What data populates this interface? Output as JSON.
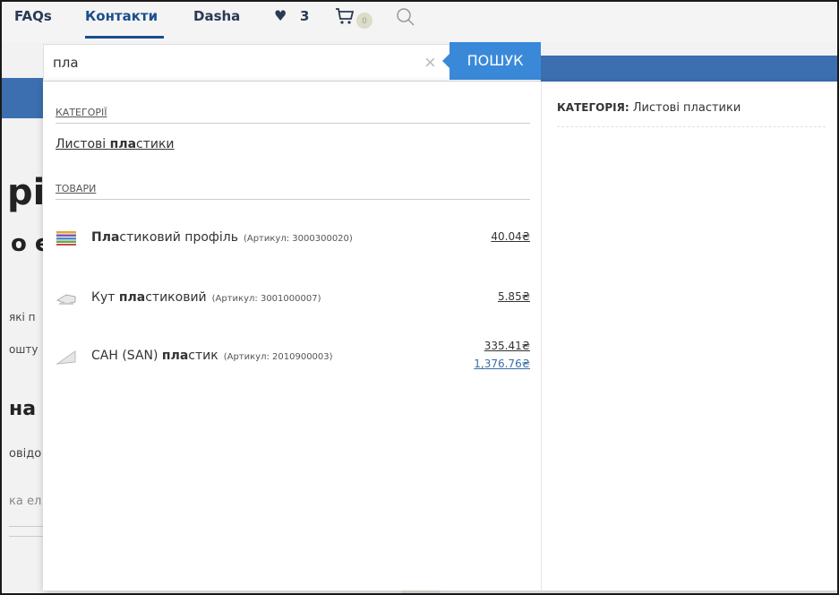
{
  "nav": {
    "faqs": "FAQs",
    "contacts": "Контакти",
    "user": "Dasha",
    "wishlist_count": "3",
    "cart_count": "0"
  },
  "background": {
    "big1": "рі",
    "big2": "о є",
    "small1": "які п",
    "small2": "ошту",
    "med": "на д",
    "small3": "овідо",
    "small4": "ка ел"
  },
  "search": {
    "value": "пла",
    "button_label": "ПОШУК"
  },
  "dropdown": {
    "categories_heading": "КАТЕГОРІЇ",
    "category_link": {
      "prefix": "Листові ",
      "bold": "пла",
      "suffix": "стики"
    },
    "products_heading": "ТОВАРИ",
    "products": [
      {
        "bold": "Пла",
        "rest": "стиковий профіль",
        "sku": "(Артикул: 3000300020)",
        "price": "40.04₴",
        "price2": ""
      },
      {
        "prefix": "Кут ",
        "bold": "пла",
        "rest": "стиковий",
        "sku": "(Артикул: 3001000007)",
        "price": "5.85₴",
        "price2": ""
      },
      {
        "prefix": "САН (SAN) ",
        "bold": "пла",
        "rest": "стик",
        "sku": "(Артикул: 2010900003)",
        "price": "335.41₴",
        "price2": "1,376.76₴"
      }
    ],
    "right": {
      "label": "КАТЕГОРІЯ:",
      "value": " Листові пластики"
    }
  },
  "colors": {
    "accent": "#3a89d9",
    "brand_bar": "#3c6fb0",
    "nav_active": "#1b4e8c"
  }
}
